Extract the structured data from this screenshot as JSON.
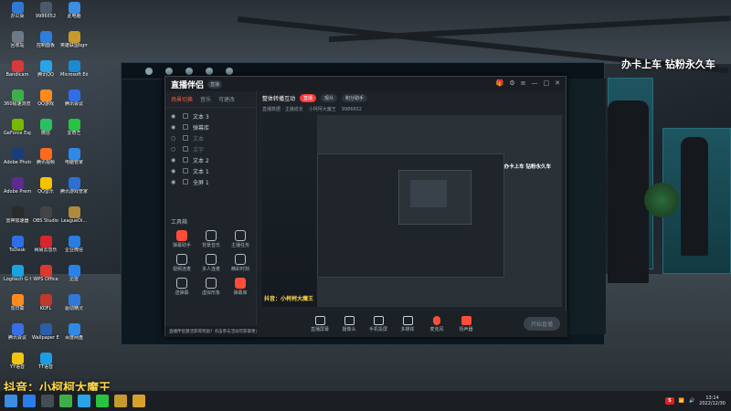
{
  "stream_overlay": {
    "top_right": "办卡上车 钻粉永久车",
    "bottom_left": "抖音：小柯柯大魔王"
  },
  "desktop_icons": [
    {
      "label": "办公桌",
      "color": "#2e78d6"
    },
    {
      "label": "9986652",
      "color": "#4a5a6a"
    },
    {
      "label": "此电脑",
      "color": "#3a8de0"
    },
    {
      "label": "回收站",
      "color": "#6d7a86"
    },
    {
      "label": "控制面板",
      "color": "#2f7dd8"
    },
    {
      "label": "英雄联盟bgm",
      "color": "#c79a2e"
    },
    {
      "label": "Bandicam",
      "color": "#d63a3a"
    },
    {
      "label": "腾讯QQ",
      "color": "#2aa4e6"
    },
    {
      "label": "Microsoft Edge",
      "color": "#1c8ad3"
    },
    {
      "label": "360极速浏览器",
      "color": "#3fae4a"
    },
    {
      "label": "QQ游戏",
      "color": "#ff8a1e"
    },
    {
      "label": "腾讯会议",
      "color": "#2f6ee6"
    },
    {
      "label": "GeForce Experience",
      "color": "#76b900"
    },
    {
      "label": "微信",
      "color": "#2ac05f"
    },
    {
      "label": "爱奇艺",
      "color": "#28c340"
    },
    {
      "label": "Adobe Photoshop",
      "color": "#1a3d7c"
    },
    {
      "label": "腾讯视频",
      "color": "#ff6a1e"
    },
    {
      "label": "电脑管家",
      "color": "#2e8ae6"
    },
    {
      "label": "Adobe Premiere",
      "color": "#5c2c8f"
    },
    {
      "label": "QQ音乐",
      "color": "#f5c300"
    },
    {
      "label": "腾讯游戏管家",
      "color": "#2e6fd1"
    },
    {
      "label": "雷神加速器",
      "color": "#2a2a2a"
    },
    {
      "label": "OBS Studio",
      "color": "#444444"
    },
    {
      "label": "LeagueDi...",
      "color": "#b08a3a"
    },
    {
      "label": "ToDesk",
      "color": "#2e6ee6"
    },
    {
      "label": "网易云音乐",
      "color": "#d8262e"
    },
    {
      "label": "企业微信",
      "color": "#2a7de0"
    },
    {
      "label": "Logitech G HUB",
      "color": "#1aa3e0"
    },
    {
      "label": "WPS Office",
      "color": "#d83a2e"
    },
    {
      "label": "迅雷",
      "color": "#2a82e6"
    },
    {
      "label": "向日葵",
      "color": "#ff8a1e"
    },
    {
      "label": "KOFL",
      "color": "#c0392b"
    },
    {
      "label": "驱动精灵",
      "color": "#2f7ad8"
    },
    {
      "label": "腾讯会议",
      "color": "#3a6ee6"
    },
    {
      "label": "Wallpaper Engine",
      "color": "#2a5ea6"
    },
    {
      "label": "百度网盘",
      "color": "#2e8ae6"
    },
    {
      "label": "YY语音",
      "color": "#f1c40f"
    },
    {
      "label": "TT语音",
      "color": "#1c9de6"
    }
  ],
  "app": {
    "logo": "直播伴侣",
    "version": "直播",
    "side_tabs": [
      "场景切换",
      "音乐",
      "可建改"
    ],
    "scenes": [
      {
        "label": "文本 3",
        "visible": true
      },
      {
        "label": "弹幕库",
        "visible": true
      },
      {
        "label": "文本",
        "visible": false
      },
      {
        "label": "文字",
        "visible": false
      },
      {
        "label": "文本 2",
        "visible": true
      },
      {
        "label": "文本 1",
        "visible": true
      },
      {
        "label": "全屏 1",
        "visible": true
      }
    ],
    "tools_title": "工具箱",
    "tools": [
      {
        "label": "弹幕助手",
        "red": true
      },
      {
        "label": "背景音乐",
        "red": false
      },
      {
        "label": "主播任务",
        "red": false
      },
      {
        "label": "视频连麦",
        "red": false
      },
      {
        "label": "多人连麦",
        "red": false
      },
      {
        "label": "精彩时刻",
        "red": false
      },
      {
        "label": "送弹幕",
        "red": false
      },
      {
        "label": "虚拟形象",
        "red": false
      },
      {
        "label": "弹幕库",
        "red": true
      }
    ],
    "notice": "直播伴侣激活获得奖励？点击参与活动可获取更多奖励",
    "room_title": "整体转播互动",
    "room_badges": [
      "直播",
      "观众",
      "积分助手"
    ],
    "room_info": [
      "直播数据 · 主播成长",
      "小柯柯大魔王",
      "9986652"
    ],
    "preview_top": "办卡上车 钻粉永久车",
    "preview_bottom": "抖音：小柯柯大魔王",
    "controls": [
      "直播屏幕",
      "摄像头",
      "手机投屏",
      "多媒体",
      "麦克风",
      "扬声器"
    ],
    "start_button": "开始直播"
  },
  "taskbar": {
    "apps": [
      "#2b7de9",
      "#444c55",
      "#3fae4a",
      "#2aa4e6",
      "#28c340",
      "#c79a2e",
      "#d8a12e"
    ],
    "time": "13:14",
    "date": "2022/12/30",
    "badge": "S"
  }
}
